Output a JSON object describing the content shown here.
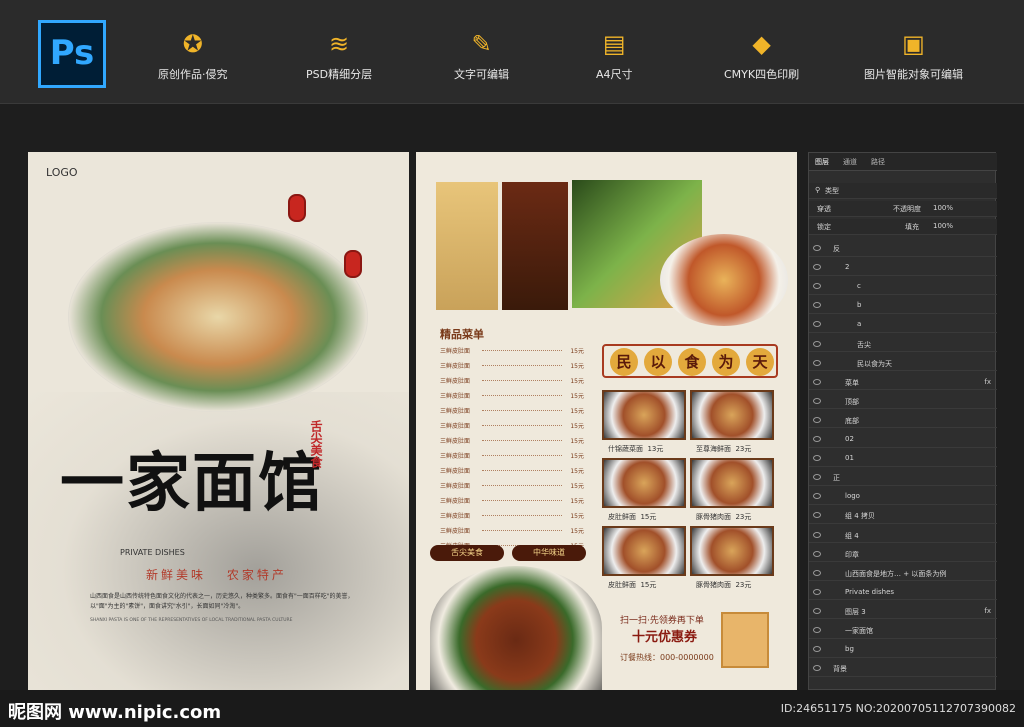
{
  "topbar": {
    "logo": "Ps",
    "features": [
      {
        "icon": "medal-icon",
        "glyph": "✪",
        "label": "原创作品·侵究"
      },
      {
        "icon": "layers-icon",
        "glyph": "≋",
        "label": "PSD精细分层"
      },
      {
        "icon": "pencil-icon",
        "glyph": "✎",
        "label": "文字可编辑"
      },
      {
        "icon": "document-icon",
        "glyph": "▤",
        "label": "A4尺寸"
      },
      {
        "icon": "paint-bucket-icon",
        "glyph": "◆",
        "label": "CMYK四色印刷"
      },
      {
        "icon": "image-icon",
        "glyph": "▣",
        "label": "图片智能对象可编辑"
      }
    ]
  },
  "poster_front": {
    "logo": "LOGO",
    "title": "一家面馆",
    "seal": "舌尖美食",
    "private": "PRIVATE DISHES",
    "tags": [
      "新鲜美味",
      "农家特产"
    ],
    "desc": "山西面食是山西传统特色面食文化的代表之一，历史悠久，种类繁多。面食有\"一面百样吃\"的美誉，以\"面\"为主的\"素饼\"，面食讲究\"水引\"，长面如同\"冷淘\"。",
    "desc_en": "SHANXI PASTA IS ONE OF THE REPRESENTATIVES OF LOCAL TRADITIONAL PASTA CULTURE"
  },
  "poster_back": {
    "menu_title": "精品菜单",
    "menu_items": [
      {
        "name": "三鲜皮肚面",
        "price": "15元"
      },
      {
        "name": "三鲜皮肚面",
        "price": "15元"
      },
      {
        "name": "三鲜皮肚面",
        "price": "15元"
      },
      {
        "name": "三鲜皮肚面",
        "price": "15元"
      },
      {
        "name": "三鲜皮肚面",
        "price": "15元"
      },
      {
        "name": "三鲜皮肚面",
        "price": "15元"
      },
      {
        "name": "三鲜皮肚面",
        "price": "15元"
      },
      {
        "name": "三鲜皮肚面",
        "price": "15元"
      },
      {
        "name": "三鲜皮肚面",
        "price": "15元"
      },
      {
        "name": "三鲜皮肚面",
        "price": "15元"
      },
      {
        "name": "三鲜皮肚面",
        "price": "15元"
      },
      {
        "name": "三鲜皮肚面",
        "price": "15元"
      },
      {
        "name": "三鲜皮肚面",
        "price": "15元"
      },
      {
        "name": "三鲜皮肚面",
        "price": "15元"
      }
    ],
    "slogan": [
      "民",
      "以",
      "食",
      "为",
      "天"
    ],
    "dishes": [
      {
        "name": "什锦蔬菜面",
        "price": "13元"
      },
      {
        "name": "至尊海鲜面",
        "price": "23元"
      },
      {
        "name": "皮肚鲜面",
        "price": "15元"
      },
      {
        "name": "豚骨猪肉面",
        "price": "23元"
      },
      {
        "name": "皮肚鲜面",
        "price": "15元"
      },
      {
        "name": "豚骨猪肉面",
        "price": "23元"
      }
    ],
    "tags": [
      "舌尖美食",
      "中华味道"
    ],
    "coupon_line": "扫一扫·先领券再下单",
    "coupon_big": "十元优惠券",
    "order": "订餐热线：000-0000000"
  },
  "layers_panel": {
    "tabs": [
      "图层",
      "通道",
      "路径"
    ],
    "filter_label": "类型",
    "blend_mode": "穿透",
    "opacity_label": "不透明度",
    "opacity": "100%",
    "lock_label": "锁定",
    "fill_label": "填充",
    "fill": "100%",
    "rows": [
      {
        "name": "反",
        "indent": 0,
        "fx": ""
      },
      {
        "name": "2",
        "indent": 1,
        "fx": ""
      },
      {
        "name": "c",
        "indent": 2,
        "fx": ""
      },
      {
        "name": "b",
        "indent": 2,
        "fx": ""
      },
      {
        "name": "a",
        "indent": 2,
        "fx": ""
      },
      {
        "name": "舌尖",
        "indent": 2,
        "fx": ""
      },
      {
        "name": "民以食为天",
        "indent": 2,
        "fx": ""
      },
      {
        "name": "菜单",
        "indent": 1,
        "fx": "fx"
      },
      {
        "name": "顶部",
        "indent": 1,
        "fx": ""
      },
      {
        "name": "底部",
        "indent": 1,
        "fx": ""
      },
      {
        "name": "02",
        "indent": 1,
        "fx": ""
      },
      {
        "name": "01",
        "indent": 1,
        "fx": ""
      },
      {
        "name": "正",
        "indent": 0,
        "fx": ""
      },
      {
        "name": "logo",
        "indent": 1,
        "fx": ""
      },
      {
        "name": "组 4 拷贝",
        "indent": 1,
        "fx": ""
      },
      {
        "name": "组 4",
        "indent": 1,
        "fx": ""
      },
      {
        "name": "印章",
        "indent": 1,
        "fx": ""
      },
      {
        "name": "山西面食是地方… + 以面条为例",
        "indent": 1,
        "fx": ""
      },
      {
        "name": "Private dishes",
        "indent": 1,
        "fx": ""
      },
      {
        "name": "图层 3",
        "indent": 1,
        "fx": "fx"
      },
      {
        "name": "一家面馆",
        "indent": 1,
        "fx": ""
      },
      {
        "name": "bg",
        "indent": 1,
        "fx": ""
      },
      {
        "name": "背景",
        "indent": 0,
        "fx": ""
      }
    ]
  },
  "watermark": {
    "left": "昵图网 www.nipic.com",
    "right": "ID:24651175 NO:20200705112707390082"
  }
}
